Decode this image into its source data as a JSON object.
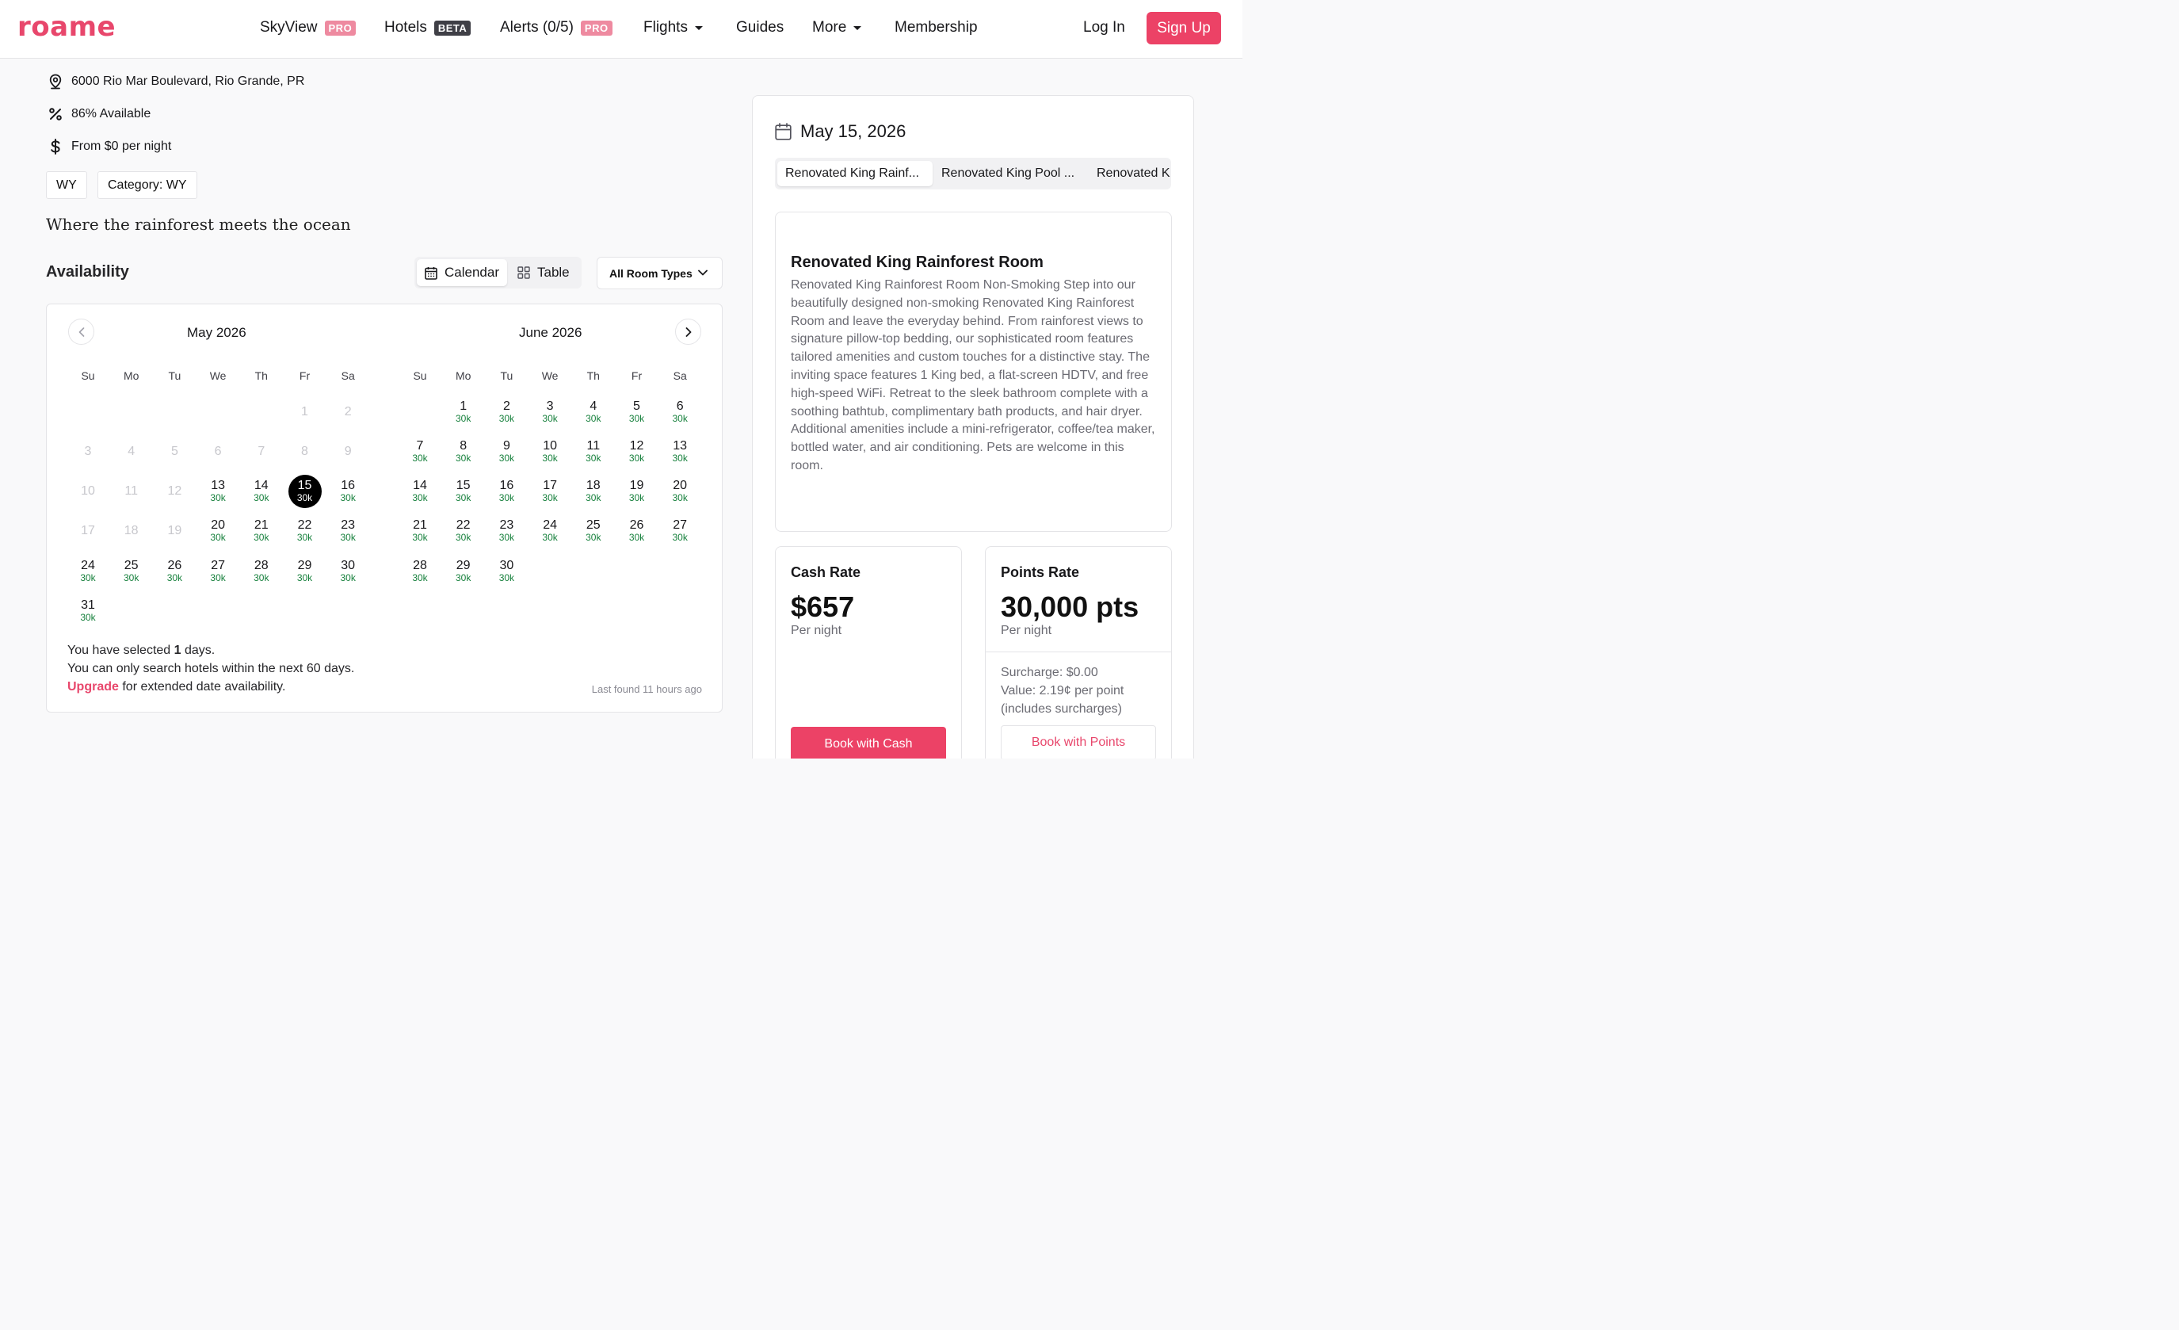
{
  "nav": {
    "logo": "roame",
    "items": [
      {
        "label": "SkyView",
        "badge": "PRO"
      },
      {
        "label": "Hotels",
        "badge": "BETA"
      },
      {
        "label": "Alerts (0/5)",
        "badge": "PRO"
      },
      {
        "label": "Flights"
      },
      {
        "label": "Guides"
      },
      {
        "label": "More"
      },
      {
        "label": "Membership"
      }
    ],
    "login": "Log In",
    "signup": "Sign Up"
  },
  "hotel": {
    "address": "6000 Rio Mar Boulevard, Rio Grande, PR",
    "availability": "86% Available",
    "price_from": "From $0 per night",
    "tags": [
      "WY",
      "Category: WY"
    ],
    "tagline": "Where the rainforest meets the ocean"
  },
  "availability": {
    "title": "Availability",
    "view_calendar": "Calendar",
    "view_table": "Table",
    "room_filter": "All Room Types",
    "months": [
      {
        "title": "May 2026",
        "weekdays": [
          "Su",
          "Mo",
          "Tu",
          "We",
          "Th",
          "Fr",
          "Sa"
        ],
        "rows": [
          [
            null,
            null,
            null,
            null,
            null,
            {
              "d": "1"
            },
            {
              "d": "2"
            }
          ],
          [
            {
              "d": "3"
            },
            {
              "d": "4"
            },
            {
              "d": "5"
            },
            {
              "d": "6"
            },
            {
              "d": "7"
            },
            {
              "d": "8"
            },
            {
              "d": "9"
            }
          ],
          [
            {
              "d": "10"
            },
            {
              "d": "11"
            },
            {
              "d": "12"
            },
            {
              "d": "13",
              "p": "30k"
            },
            {
              "d": "14",
              "p": "30k"
            },
            {
              "d": "15",
              "p": "30k",
              "sel": true
            },
            {
              "d": "16",
              "p": "30k"
            }
          ],
          [
            {
              "d": "17"
            },
            {
              "d": "18"
            },
            {
              "d": "19"
            },
            {
              "d": "20",
              "p": "30k"
            },
            {
              "d": "21",
              "p": "30k"
            },
            {
              "d": "22",
              "p": "30k"
            },
            {
              "d": "23",
              "p": "30k"
            }
          ],
          [
            {
              "d": "24",
              "p": "30k"
            },
            {
              "d": "25",
              "p": "30k"
            },
            {
              "d": "26",
              "p": "30k"
            },
            {
              "d": "27",
              "p": "30k"
            },
            {
              "d": "28",
              "p": "30k"
            },
            {
              "d": "29",
              "p": "30k"
            },
            {
              "d": "30",
              "p": "30k"
            }
          ],
          [
            {
              "d": "31",
              "p": "30k"
            },
            null,
            null,
            null,
            null,
            null,
            null
          ]
        ]
      },
      {
        "title": "June 2026",
        "weekdays": [
          "Su",
          "Mo",
          "Tu",
          "We",
          "Th",
          "Fr",
          "Sa"
        ],
        "rows": [
          [
            null,
            {
              "d": "1",
              "p": "30k"
            },
            {
              "d": "2",
              "p": "30k"
            },
            {
              "d": "3",
              "p": "30k"
            },
            {
              "d": "4",
              "p": "30k"
            },
            {
              "d": "5",
              "p": "30k"
            },
            {
              "d": "6",
              "p": "30k"
            }
          ],
          [
            {
              "d": "7",
              "p": "30k"
            },
            {
              "d": "8",
              "p": "30k"
            },
            {
              "d": "9",
              "p": "30k"
            },
            {
              "d": "10",
              "p": "30k"
            },
            {
              "d": "11",
              "p": "30k"
            },
            {
              "d": "12",
              "p": "30k"
            },
            {
              "d": "13",
              "p": "30k"
            }
          ],
          [
            {
              "d": "14",
              "p": "30k"
            },
            {
              "d": "15",
              "p": "30k"
            },
            {
              "d": "16",
              "p": "30k"
            },
            {
              "d": "17",
              "p": "30k"
            },
            {
              "d": "18",
              "p": "30k"
            },
            {
              "d": "19",
              "p": "30k"
            },
            {
              "d": "20",
              "p": "30k"
            }
          ],
          [
            {
              "d": "21",
              "p": "30k"
            },
            {
              "d": "22",
              "p": "30k"
            },
            {
              "d": "23",
              "p": "30k"
            },
            {
              "d": "24",
              "p": "30k"
            },
            {
              "d": "25",
              "p": "30k"
            },
            {
              "d": "26",
              "p": "30k"
            },
            {
              "d": "27",
              "p": "30k"
            }
          ],
          [
            {
              "d": "28",
              "p": "30k"
            },
            {
              "d": "29",
              "p": "30k"
            },
            {
              "d": "30",
              "p": "30k"
            },
            null,
            null,
            null,
            null
          ]
        ]
      }
    ],
    "footer": {
      "selected_prefix": "You have selected ",
      "selected_count": "1",
      "selected_suffix": " days.",
      "limit": "You can only search hotels within the next 60 days.",
      "upgrade": "Upgrade",
      "upgrade_suffix": " for extended date availability.",
      "last_found": "Last found 11 hours ago"
    }
  },
  "detail": {
    "date": "May 15, 2026",
    "room_tabs": [
      "Renovated King Rainf...",
      "Renovated King Pool ...",
      "Renovated K"
    ],
    "room_title": "Renovated King Rainforest Room",
    "room_description": "Renovated King Rainforest Room Non-Smoking Step into our beautifully designed non-smoking Renovated King Rainforest Room and leave the everyday behind. From rainforest views to signature pillow-top bedding, our sophisticated room features tailored amenities and custom touches for a distinctive stay. The inviting space features 1 King bed, a flat-screen HDTV, and free high-speed WiFi. Retreat to the sleek bathroom complete with a soothing bathtub, complimentary bath products, and hair dryer. Additional amenities include a mini-refrigerator, coffee/tea maker, bottled water, and air conditioning. Pets are welcome in this room.",
    "cash": {
      "title": "Cash Rate",
      "value": "$657",
      "sub": "Per night",
      "button": "Book with Cash"
    },
    "points": {
      "title": "Points Rate",
      "value": "30,000 pts",
      "sub": "Per night",
      "surcharge": "Surcharge: $0.00",
      "value_per_point": "Value: 2.19¢ per point",
      "includes": "(includes surcharges)",
      "button": "Book with Points"
    }
  },
  "colors": {
    "brand": "#ec4266",
    "points_green": "#16803c"
  }
}
